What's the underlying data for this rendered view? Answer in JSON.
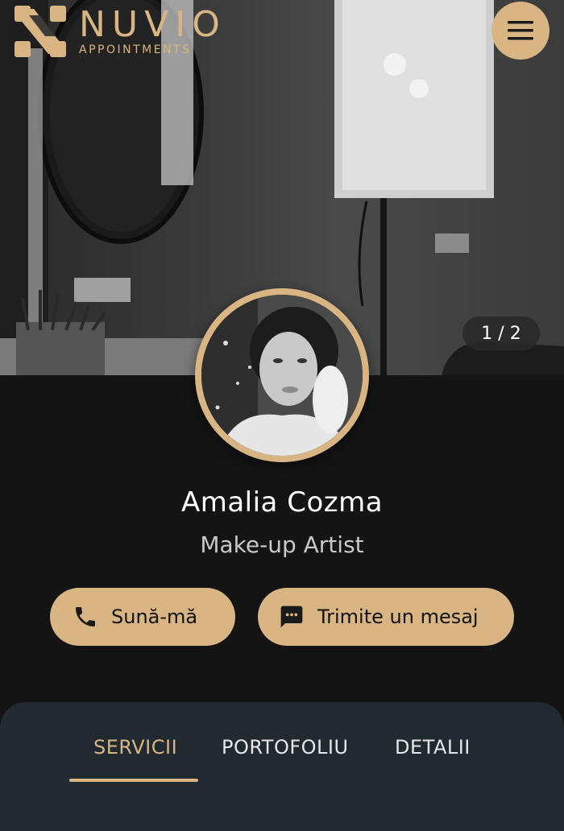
{
  "brand": {
    "name": "NUVIO",
    "subtitle": "APPOINTMENTS",
    "accent_color": "#d8b583"
  },
  "header": {
    "menu_icon": "hamburger-menu-icon"
  },
  "gallery": {
    "counter": "1 / 2"
  },
  "profile": {
    "name": "Amalia Cozma",
    "role": "Make-up Artist"
  },
  "actions": {
    "call_label": "Sună-mă",
    "call_icon": "phone-icon",
    "message_label": "Trimite un mesaj",
    "message_icon": "chat-icon"
  },
  "tabs": [
    {
      "label": "SERVICII",
      "active": true
    },
    {
      "label": "PORTOFOLIU",
      "active": false
    },
    {
      "label": "DETALII",
      "active": false
    }
  ]
}
